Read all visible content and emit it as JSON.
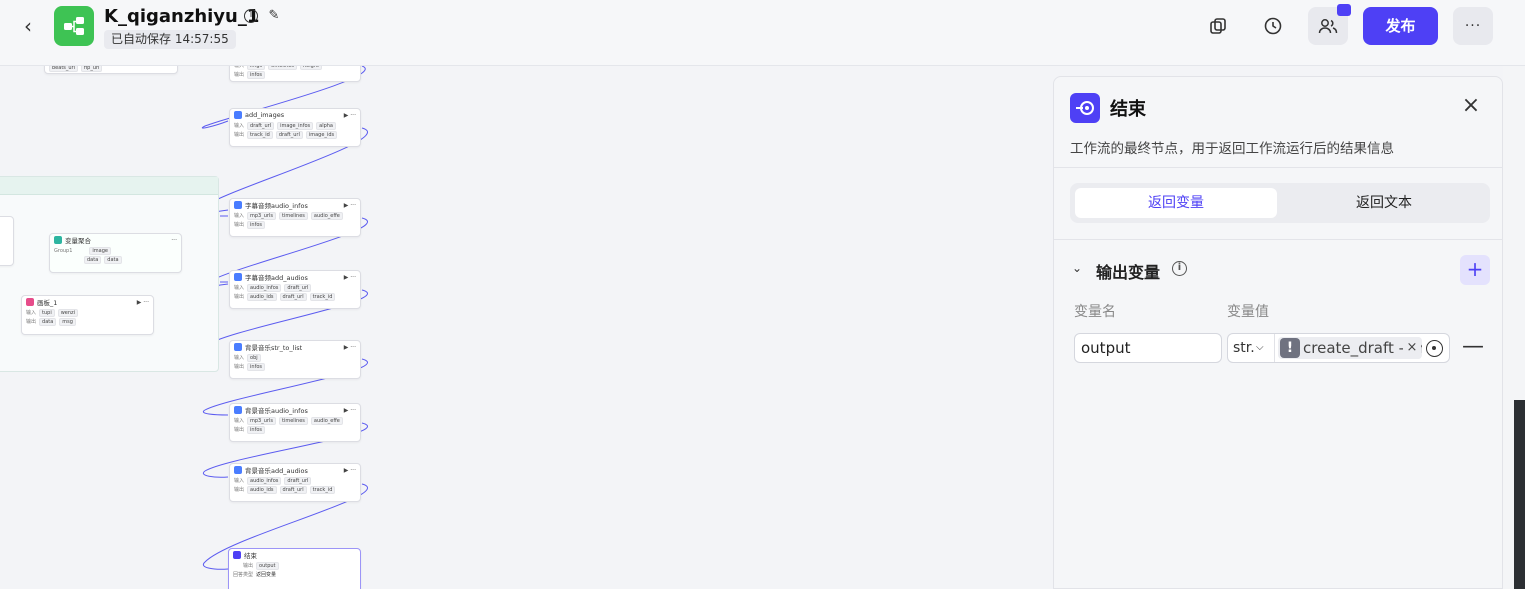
{
  "header": {
    "back_icon": "chevron-left-icon",
    "app_title": "K_qiganzhiyu_1",
    "autosave": "已自动保存 14:57:55",
    "publish_label": "发布",
    "more_label": "···"
  },
  "canvas": {
    "nodes": [
      {
        "title": "add_images",
        "in_label": "输入",
        "in": [
          "draft_url",
          "image_infos",
          "alpha"
        ],
        "out_label": "输出",
        "out": [
          "track_id",
          "draft_url",
          "image_ids"
        ]
      },
      {
        "title": "字幕音频audio_infos",
        "in_label": "输入",
        "in": [
          "mp3_urls",
          "timelines",
          "audio_effe"
        ],
        "out_label": "输出",
        "out": [
          "infos"
        ]
      },
      {
        "title": "字幕音频add_audios",
        "in_label": "输入",
        "in": [
          "audio_infos",
          "draft_url"
        ],
        "out_label": "输出",
        "out": [
          "audio_ids",
          "draft_url",
          "track_id"
        ]
      },
      {
        "title": "背景音乐str_to_list",
        "in_label": "输入",
        "in": [
          "obj"
        ],
        "out_label": "输出",
        "out": [
          "infos"
        ]
      },
      {
        "title": "背景音乐audio_infos",
        "in_label": "输入",
        "in": [
          "mp3_urls",
          "timelines",
          "audio_effe"
        ],
        "out_label": "输出",
        "out": [
          "infos"
        ]
      },
      {
        "title": "背景音乐add_audios",
        "in_label": "输入",
        "in": [
          "audio_infos",
          "draft_url"
        ],
        "out_label": "输出",
        "out": [
          "audio_ids",
          "draft_url",
          "track_id"
        ]
      },
      {
        "title": "结束",
        "in_label": "输出",
        "in": [
          "output"
        ],
        "out_label": "回答类型",
        "out": [
          "返回变量"
        ]
      }
    ],
    "top_node": {
      "in_label": "输入",
      "in": [
        "imgs",
        "timelines",
        "height"
      ],
      "out_label": "输出",
      "out": [
        "infos"
      ]
    },
    "top_left_node": {
      "out": [
        "beats_url",
        "fip_url"
      ]
    },
    "var_node": {
      "title": "变量聚合",
      "sub": "Group1",
      "chips": [
        "image"
      ],
      "out": [
        "data",
        "data"
      ]
    },
    "draw_node": {
      "title": "画板_1",
      "in_label": "输入",
      "in": [
        "tupi",
        "wenzi"
      ],
      "out_label": "输出",
      "out": [
        "data",
        "msg"
      ]
    }
  },
  "panel": {
    "title": "结束",
    "description": "工作流的最终节点，用于返回工作流运行后的结果信息",
    "tabs": [
      "返回变量",
      "返回文本"
    ],
    "section_title": "输出变量",
    "col_name": "变量名",
    "col_value": "变量值",
    "output_name": "output",
    "value_type": "str.",
    "value_ref": "create_draft - draft_url",
    "accent": "#4e40f5"
  }
}
